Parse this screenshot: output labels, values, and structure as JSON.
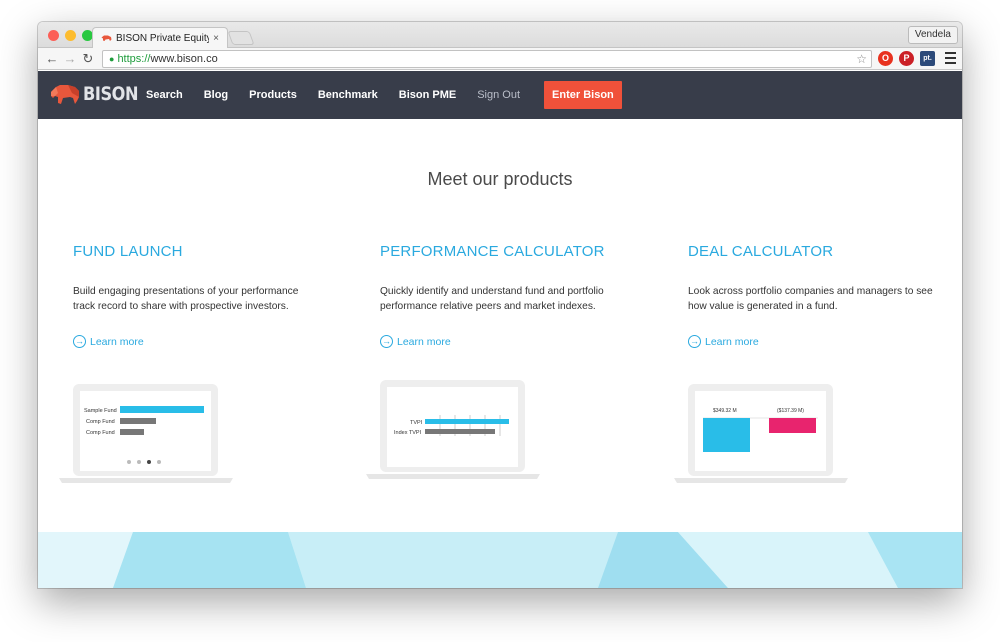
{
  "browser": {
    "tab_title": "BISON Private Equity Bench",
    "tab_close": "×",
    "user": "Vendela",
    "url_scheme": "https://",
    "url_host": "www.bison.co",
    "back": "←",
    "forward": "→",
    "reload": "↻",
    "ext_pt": "pt."
  },
  "site": {
    "logo_text": "BISON",
    "nav": [
      "Search",
      "Blog",
      "Products",
      "Benchmark",
      "Bison PME"
    ],
    "sign_out": "Sign Out",
    "enter": "Enter Bison",
    "colors": {
      "nav_bg": "#383d4a",
      "cta": "#f0513a",
      "accent": "#2aa9df",
      "pink": "#e8246e"
    }
  },
  "page": {
    "heading": "Meet our products",
    "learn_more": "Learn more",
    "products": [
      {
        "title": "FUND LAUNCH",
        "desc": "Build engaging presentations of your performance track record to share with prospective investors.",
        "chart_labels": [
          "Sample Fund",
          "Comp Fund",
          "Comp Fund"
        ]
      },
      {
        "title": "PERFORMANCE CALCULATOR",
        "desc": "Quickly identify and understand fund and portfolio performance relative peers and market indexes.",
        "chart_labels": [
          "TVPI",
          "Index TVPI"
        ]
      },
      {
        "title": "DEAL CALCULATOR",
        "desc": "Look across portfolio companies and managers to see how value is generated in a fund.",
        "chart_labels": [
          "$349.32 M",
          "($137.39 M)"
        ]
      }
    ]
  }
}
